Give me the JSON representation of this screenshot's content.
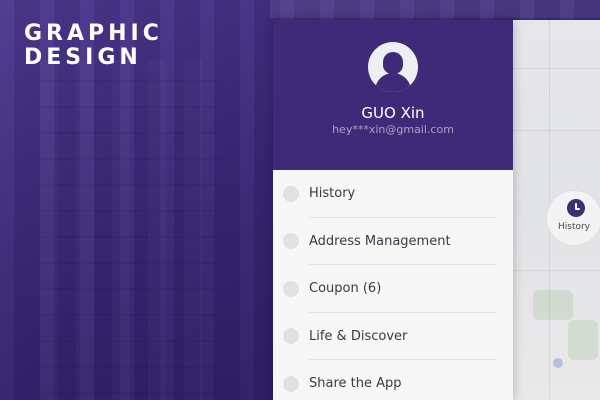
{
  "brand": {
    "line1": "GRAPHIC",
    "line2": "DESIGN"
  },
  "user": {
    "name": "GUO Xin",
    "email": "hey***xin@gmail.com"
  },
  "menu": {
    "items": [
      {
        "label": "History"
      },
      {
        "label": "Address Management"
      },
      {
        "label": "Coupon (6)"
      },
      {
        "label": "Life & Discover"
      },
      {
        "label": "Share the App"
      }
    ]
  },
  "map": {
    "history_button_label": "History"
  },
  "colors": {
    "brand_purple": "#3f2a79",
    "drawer_bg": "#f7f7f8",
    "text_dark": "#3a3a46"
  }
}
